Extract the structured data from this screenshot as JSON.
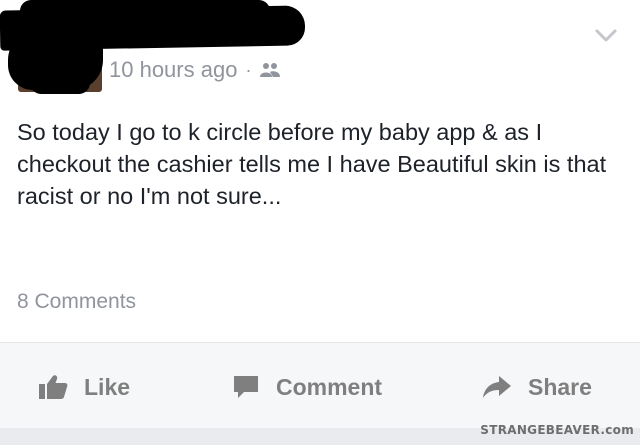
{
  "post": {
    "timestamp": "10 hours ago",
    "separator": "·",
    "audience_icon": "friends-icon",
    "text": "So today I go to k circle before my baby app & as I checkout the cashier tells me I have Beautiful skin is that racist or no I'm not sure...",
    "comments_count": "8 Comments"
  },
  "actions": {
    "like_label": "Like",
    "comment_label": "Comment",
    "share_label": "Share"
  },
  "icons": {
    "options": "chevron-down-icon",
    "like": "thumbs-up-icon",
    "comment": "speech-bubble-icon",
    "share": "share-arrow-icon"
  },
  "colors": {
    "meta_text": "#90949c",
    "body_text": "#1d2129",
    "action_text": "#7f7f7f",
    "action_bar_bg": "#f6f7f9"
  },
  "watermark": "STRANGEBEAVER.com"
}
